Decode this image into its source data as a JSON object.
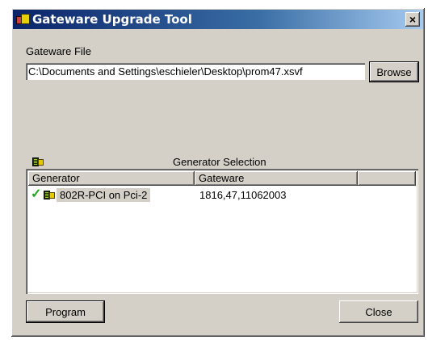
{
  "window": {
    "title": "Gateware Upgrade Tool",
    "close_glyph": "×"
  },
  "gateware_file": {
    "label": "Gateware File",
    "path": "C:\\Documents and Settings\\eschieler\\Desktop\\prom47.xsvf",
    "browse_label": "Browse"
  },
  "generator_selection": {
    "title": "Generator Selection",
    "icon": "generator-board-icon",
    "columns": [
      "Generator",
      "Gateware",
      ""
    ],
    "rows": [
      {
        "checked": true,
        "generator": "802R-PCI on Pci-2",
        "gateware": "1816,47,11062003"
      }
    ]
  },
  "buttons": {
    "program": "Program",
    "close": "Close"
  },
  "colors": {
    "titlebar_start": "#0a246a",
    "titlebar_end": "#a6caf0",
    "face": "#d4d0c8",
    "check": "#1fa81f"
  }
}
